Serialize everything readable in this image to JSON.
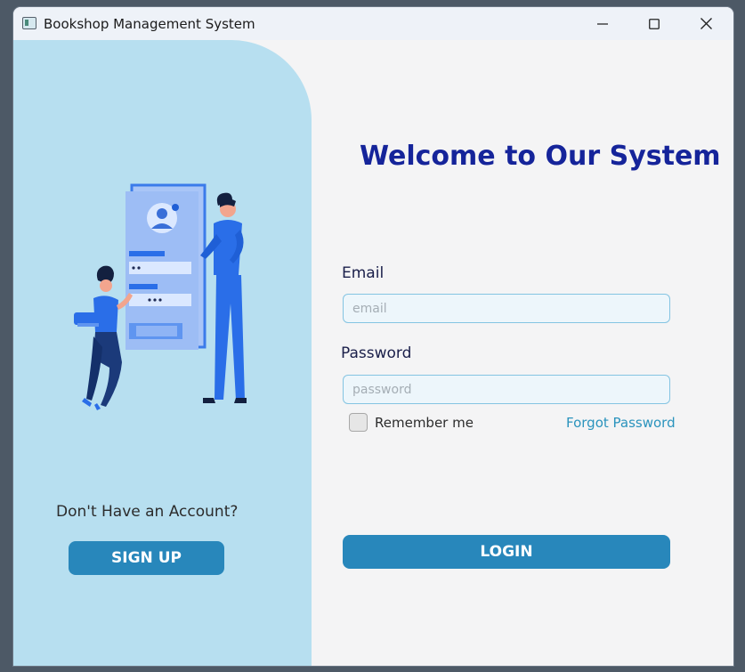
{
  "window": {
    "title": "Bookshop Management System"
  },
  "left": {
    "signup_question": "Don't Have an Account?",
    "signup_label": "SIGN UP"
  },
  "form": {
    "heading": "Welcome to Our System",
    "email_label": "Email",
    "email_placeholder": "email",
    "email_value": "",
    "password_label": "Password",
    "password_placeholder": "password",
    "password_value": "",
    "remember_label": "Remember me",
    "remember_checked": false,
    "forgot_label": "Forgot Password",
    "login_label": "LOGIN"
  },
  "colors": {
    "accent": "#2887bb",
    "heading": "#15249a",
    "left_panel_bg": "#b7dff0",
    "link": "#2a93bd"
  },
  "icons": [
    "app-icon",
    "minimize-icon",
    "maximize-icon",
    "close-icon",
    "login-illustration"
  ]
}
